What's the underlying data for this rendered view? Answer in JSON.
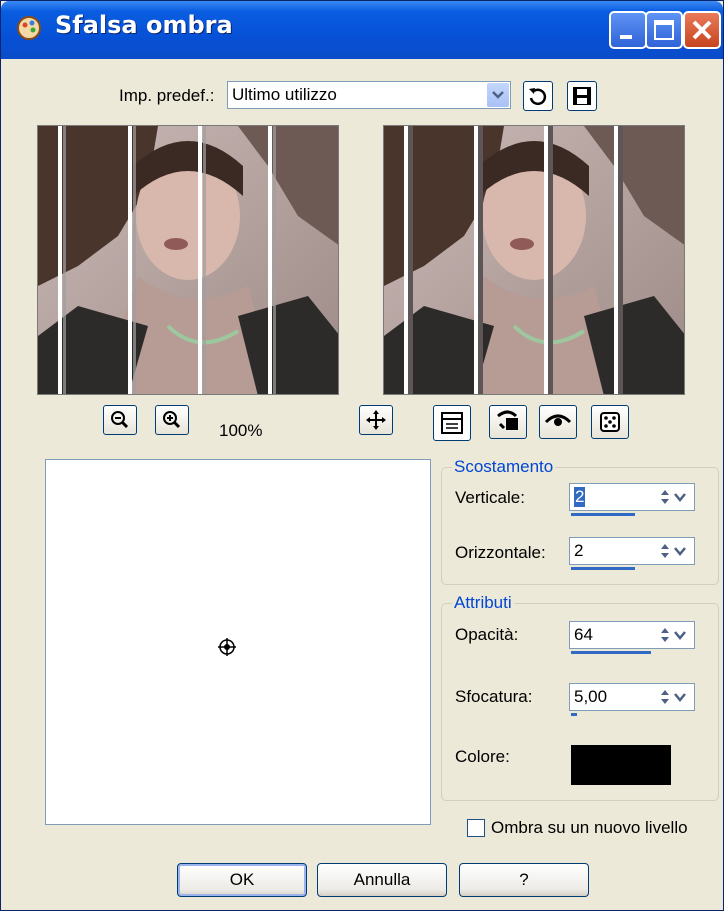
{
  "window": {
    "title": "Sfalsa ombra"
  },
  "preset": {
    "label": "Imp. predef.:",
    "value": "Ultimo utilizzo"
  },
  "zoom": {
    "level": "100%"
  },
  "offset_group": {
    "title": "Scostamento",
    "vertical": {
      "label": "Verticale:",
      "value": "2"
    },
    "horizontal": {
      "label": "Orizzontale:",
      "value": "2"
    }
  },
  "attributes_group": {
    "title": "Attributi",
    "opacity": {
      "label": "Opacità:",
      "value": "64"
    },
    "blur": {
      "label": "Sfocatura:",
      "value": "5,00"
    },
    "color": {
      "label": "Colore:",
      "swatch": "#000000"
    }
  },
  "new_layer": {
    "label": "Ombra su un nuovo livello",
    "checked": false
  },
  "buttons": {
    "ok": "OK",
    "cancel": "Annulla",
    "help": "?"
  },
  "colors": {
    "titlebar": "#0a5de0",
    "dialog_bg": "#ece9d8",
    "accent": "#316ac5",
    "group_title": "#0046d5"
  },
  "icons": [
    "app-icon",
    "minimize-icon",
    "maximize-icon",
    "close-icon",
    "reset-icon",
    "save-icon",
    "zoom-out-icon",
    "zoom-in-icon",
    "pan-icon",
    "proof-icon",
    "preset-randomize-icon",
    "eye-icon",
    "dice-icon",
    "crosshair-icon"
  ]
}
